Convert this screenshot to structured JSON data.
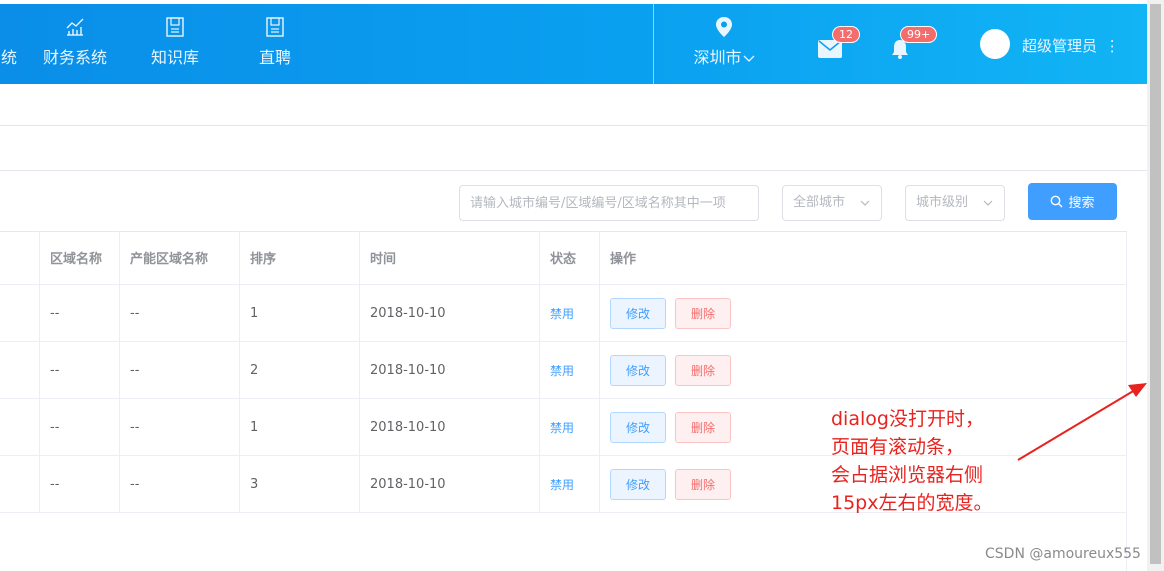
{
  "header": {
    "nav": [
      {
        "label": "统",
        "icon": "system-icon"
      },
      {
        "label": "财务系统",
        "icon": "finance-chart-icon"
      },
      {
        "label": "知识库",
        "icon": "document-icon"
      },
      {
        "label": "直聘",
        "icon": "document-icon"
      }
    ],
    "city": "深圳市",
    "mail_badge": "12",
    "bell_badge": "99+",
    "user_name": "超级管理员"
  },
  "filters": {
    "search_placeholder": "请输入城市编号/区域编号/区域名称其中一项",
    "city_select": "全部城市",
    "level_select": "城市级别",
    "search_button": "搜索"
  },
  "table": {
    "columns": [
      "区域名称",
      "产能区域名称",
      "排序",
      "时间",
      "状态",
      "操作"
    ],
    "rows": [
      {
        "area": "--",
        "capacity_area": "--",
        "order": "1",
        "time": "2018-10-10",
        "status": "禁用",
        "edit": "修改",
        "delete": "删除"
      },
      {
        "area": "--",
        "capacity_area": "--",
        "order": "2",
        "time": "2018-10-10",
        "status": "禁用",
        "edit": "修改",
        "delete": "删除"
      },
      {
        "area": "--",
        "capacity_area": "--",
        "order": "1",
        "time": "2018-10-10",
        "status": "禁用",
        "edit": "修改",
        "delete": "删除"
      },
      {
        "area": "--",
        "capacity_area": "--",
        "order": "3",
        "time": "2018-10-10",
        "status": "禁用",
        "edit": "修改",
        "delete": "删除"
      }
    ]
  },
  "annotation": {
    "lines": [
      "dialog没打开时，",
      "页面有滚动条，",
      "会占据浏览器右侧",
      "15px左右的宽度。"
    ]
  },
  "watermark": "CSDN @amoureux555",
  "colors": {
    "accent": "#409eff",
    "danger": "#f56c6c",
    "annotation": "#e8231f"
  }
}
